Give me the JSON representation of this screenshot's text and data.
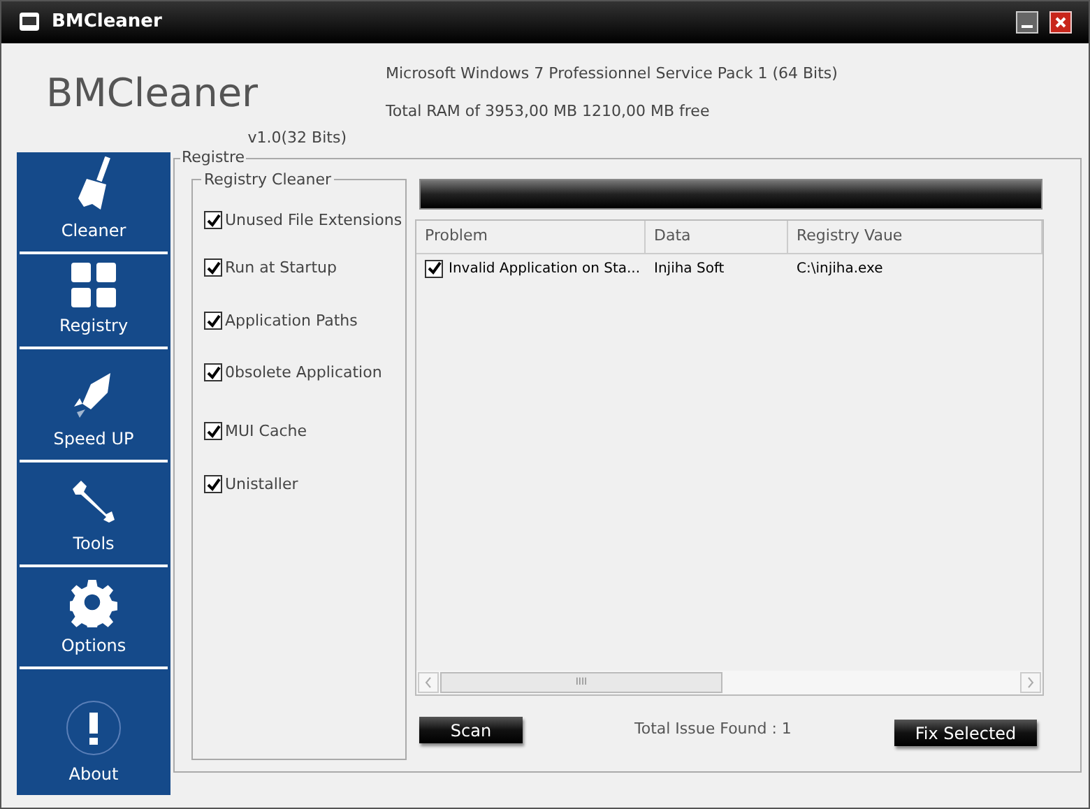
{
  "window": {
    "title": "BMCleaner"
  },
  "header": {
    "app_name": "BMCleaner",
    "version": "v1.0(32 Bits)",
    "os": "Microsoft Windows 7 Professionnel  Service Pack 1 (64 Bits)",
    "ram": "Total RAM of 3953,00 MB 1210,00 MB free"
  },
  "sidebar": {
    "items": [
      {
        "kind": "broom",
        "label": "Cleaner"
      },
      {
        "kind": "grid",
        "label": "Registry"
      },
      {
        "kind": "rocket",
        "label": "Speed UP"
      },
      {
        "kind": "wrench",
        "label": "Tools"
      },
      {
        "kind": "gear",
        "label": "Options"
      },
      {
        "kind": "alert",
        "label": "About"
      }
    ]
  },
  "group": {
    "title": "Registre"
  },
  "registry_cleaner": {
    "title": "Registry Cleaner",
    "options": [
      {
        "label": "Unused File Extensions",
        "checked": true
      },
      {
        "label": "Run at Startup",
        "checked": true
      },
      {
        "label": "Application Paths",
        "checked": true
      },
      {
        "label": "0bsolete Application",
        "checked": true
      },
      {
        "label": "MUI Cache",
        "checked": true
      },
      {
        "label": "Unistaller",
        "checked": true
      }
    ]
  },
  "table": {
    "columns": [
      "Problem",
      "Data",
      "Registry Vaue"
    ],
    "rows": [
      {
        "checked": true,
        "cells": [
          "Invalid Application on Sta...",
          "Injiha Soft",
          "C:\\injiha.exe"
        ]
      }
    ]
  },
  "progress": {
    "level": 1
  },
  "scrollbar_grip": "IIII",
  "buttons": {
    "scan": "Scan",
    "fix": "Fix Selected"
  },
  "status": "Total Issue Found : 1"
}
